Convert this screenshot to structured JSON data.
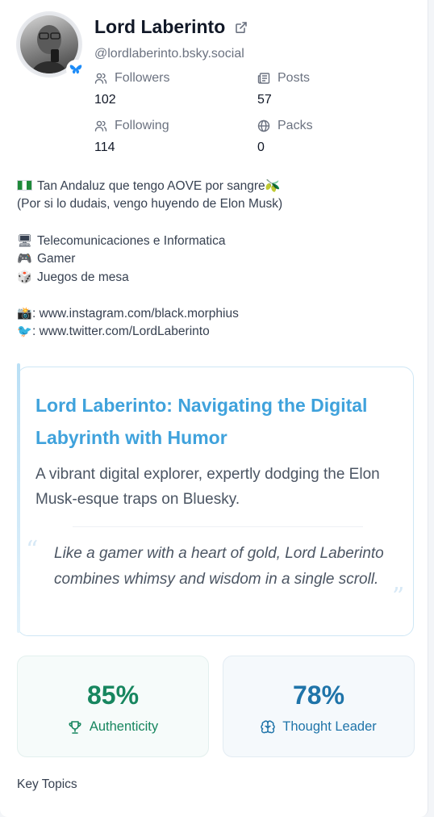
{
  "profile": {
    "display_name": "Lord Laberinto",
    "handle": "@lordlaberinto.bsky.social",
    "stats": {
      "followers": {
        "label": "Followers",
        "value": "102"
      },
      "posts": {
        "label": "Posts",
        "value": "57"
      },
      "following": {
        "label": "Following",
        "value": "114"
      },
      "packs": {
        "label": "Packs",
        "value": "0"
      }
    },
    "bio": {
      "line1": "Tan Andaluz que tengo AOVE por sangre",
      "line2": "(Por si lo dudais, vengo huyendo de Elon Musk)",
      "line3": "Telecomunicaciones e Informatica",
      "line4": "Gamer",
      "line5": "Juegos de mesa",
      "instagram": "www.instagram.com/black.morphius",
      "twitter": "www.twitter.com/LordLaberinto"
    }
  },
  "summary": {
    "title": "Lord Laberinto: Navigating the Digital Labyrinth with Humor",
    "description": "A vibrant digital explorer, expertly dodging the Elon Musk-esque traps on Bluesky.",
    "quote": "Like a gamer with a heart of gold, Lord Laberinto combines whimsy and wisdom in a single scroll.",
    "quote_open": "“",
    "quote_close": "”"
  },
  "metrics": {
    "authenticity": {
      "value": "85%",
      "label": "Authenticity",
      "color": "#17865f"
    },
    "thought_leader": {
      "value": "78%",
      "label": "Thought Leader",
      "color": "#1f74a9"
    }
  },
  "sections": {
    "key_topics": "Key Topics"
  },
  "colors": {
    "accent": "#3fa2dc",
    "bluesky": "#1d8cf8"
  }
}
